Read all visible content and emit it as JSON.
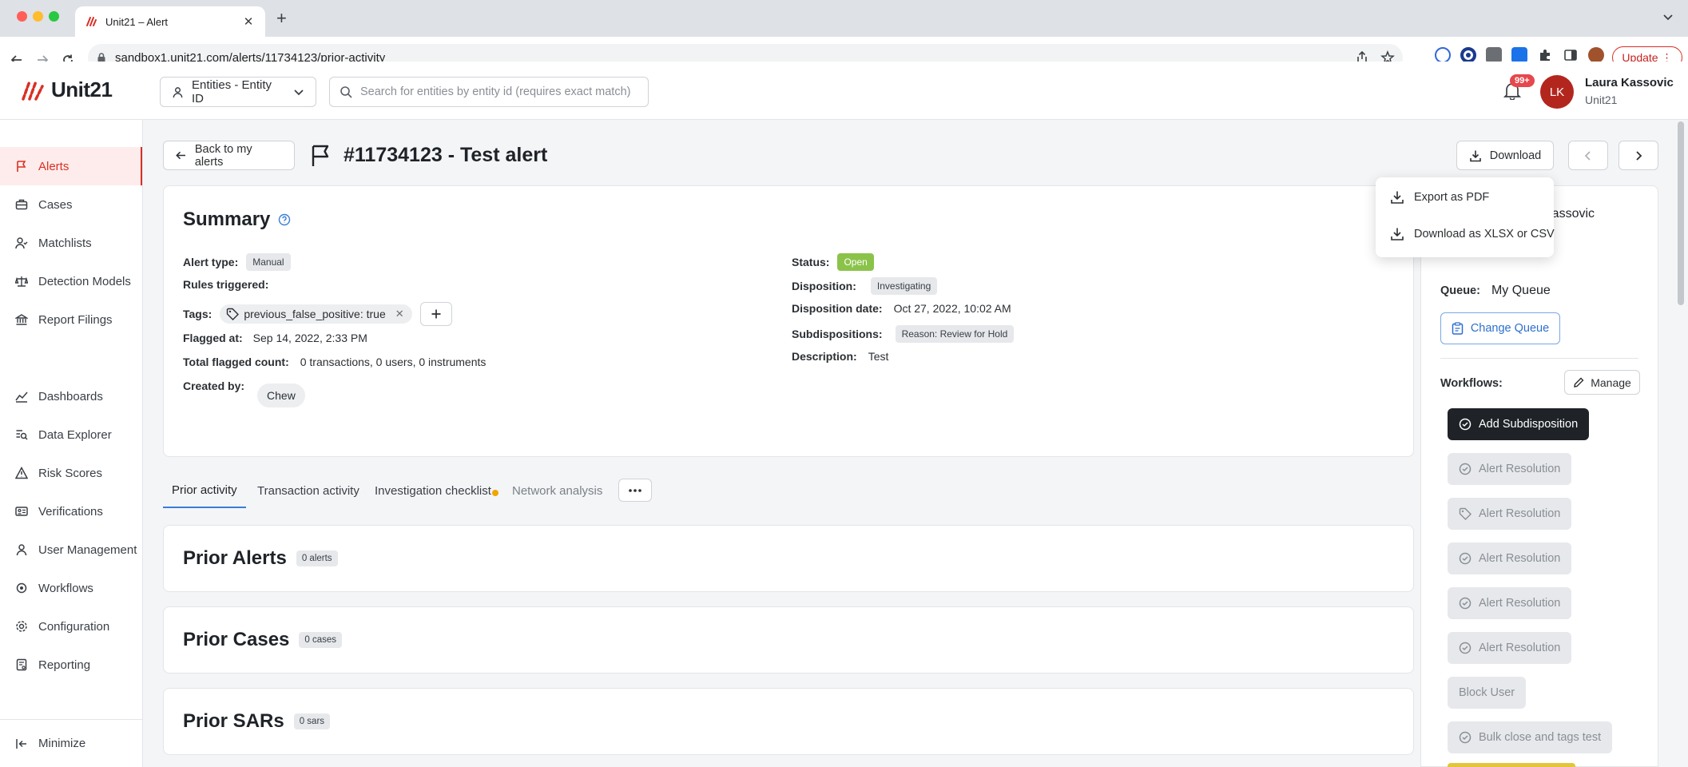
{
  "browser": {
    "tab_title": "Unit21 – Alert",
    "url": "sandbox1.unit21.com/alerts/11734123/prior-activity",
    "update_label": "Update"
  },
  "header": {
    "logo_text": "Unit21",
    "entity_select_label": "Entities - Entity ID",
    "search_placeholder": "Search for entities by entity id (requires exact match)",
    "notification_count": "99+",
    "avatar_initials": "LK",
    "user_name": "Laura Kassovic",
    "user_org": "Unit21"
  },
  "sidebar": {
    "items": [
      {
        "label": "Alerts",
        "icon": "flag-icon",
        "active": true
      },
      {
        "label": "Cases",
        "icon": "briefcase-icon",
        "active": false
      },
      {
        "label": "Matchlists",
        "icon": "user-check-icon",
        "active": false
      },
      {
        "label": "Detection Models",
        "icon": "scale-icon",
        "active": false
      },
      {
        "label": "Report Filings",
        "icon": "bank-icon",
        "active": false
      },
      {
        "label": "Dashboards",
        "icon": "chart-line-icon",
        "active": false
      },
      {
        "label": "Data Explorer",
        "icon": "data-search-icon",
        "active": false
      },
      {
        "label": "Risk Scores",
        "icon": "warning-icon",
        "active": false
      },
      {
        "label": "Verifications",
        "icon": "id-card-icon",
        "active": false
      },
      {
        "label": "User Management",
        "icon": "user-icon",
        "active": false
      },
      {
        "label": "Workflows",
        "icon": "workflow-icon",
        "active": false
      },
      {
        "label": "Configuration",
        "icon": "gear-icon",
        "active": false
      },
      {
        "label": "Reporting",
        "icon": "report-icon",
        "active": false
      }
    ],
    "minimize_label": "Minimize"
  },
  "main": {
    "back_label": "Back to my alerts",
    "title": "#11734123 - Test alert",
    "download_label": "Download",
    "summary": {
      "title": "Summary",
      "alert_type_label": "Alert type:",
      "alert_type_value": "Manual",
      "rules_triggered_label": "Rules triggered:",
      "tags_label": "Tags:",
      "tag_value": "previous_false_positive: true",
      "flagged_at_label": "Flagged at:",
      "flagged_at_value": "Sep 14, 2022, 2:33 PM",
      "total_flagged_label": "Total flagged count:",
      "total_flagged_value": "0 transactions, 0 users, 0 instruments",
      "created_by_label": "Created by:",
      "created_by_value": "Chew",
      "status_label": "Status:",
      "status_value": "Open",
      "disposition_label": "Disposition:",
      "disposition_value": "Investigating",
      "disposition_date_label": "Disposition date:",
      "disposition_date_value": "Oct 27, 2022, 10:02 AM",
      "subdispositions_label": "Subdispositions:",
      "subdispositions_value": "Reason: Review for Hold",
      "description_label": "Description:",
      "description_value": "Test"
    },
    "tabs": [
      {
        "label": "Prior activity",
        "state": "active"
      },
      {
        "label": "Transaction activity",
        "state": "normal"
      },
      {
        "label": "Investigation checklist",
        "state": "normal"
      },
      {
        "label": "Network analysis",
        "state": "muted"
      }
    ],
    "sections": [
      {
        "title": "Prior Alerts",
        "count": "0 alerts"
      },
      {
        "title": "Prior Cases",
        "count": "0 cases"
      },
      {
        "title": "Prior SARs",
        "count": "0 sars"
      }
    ]
  },
  "dropdown": {
    "items": [
      "Export as PDF",
      "Download as XLSX or CSV"
    ]
  },
  "right_panel": {
    "assignee_partial": "Kassovic",
    "queue_label": "Queue:",
    "queue_value": "My Queue",
    "change_queue_label": "Change Queue",
    "workflows_label": "Workflows:",
    "manage_label": "Manage",
    "workflows": [
      {
        "label": "Add Subdisposition",
        "style": "primary",
        "icon": "check-circle-icon"
      },
      {
        "label": "Alert Resolution",
        "style": "disabled",
        "icon": "check-circle-icon"
      },
      {
        "label": "Alert Resolution",
        "style": "disabled",
        "icon": "tag-icon"
      },
      {
        "label": "Alert Resolution",
        "style": "disabled",
        "icon": "check-circle-icon"
      },
      {
        "label": "Alert Resolution",
        "style": "disabled",
        "icon": "check-circle-icon"
      },
      {
        "label": "Alert Resolution",
        "style": "disabled",
        "icon": "check-circle-icon"
      },
      {
        "label": "Block User",
        "style": "disabled",
        "icon": ""
      },
      {
        "label": "Bulk close and tags test",
        "style": "disabled",
        "icon": "check-circle-icon"
      }
    ]
  },
  "colors": {
    "brand_red": "#d93025",
    "status_open_green": "#8bc34a",
    "link_blue": "#2d6fce",
    "primary_dark": "#1f2328"
  }
}
